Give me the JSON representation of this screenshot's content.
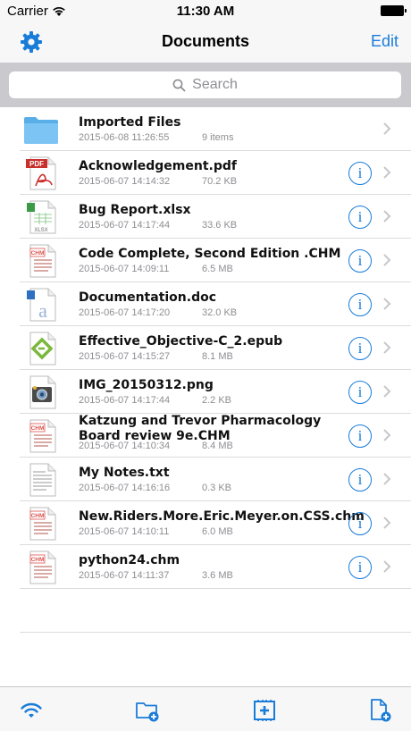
{
  "status": {
    "carrier": "Carrier",
    "time": "11:30 AM"
  },
  "nav": {
    "title": "Documents",
    "edit_label": "Edit"
  },
  "search": {
    "placeholder": "Search"
  },
  "accent_color": "#1a7cd9",
  "files": [
    {
      "name": "Imported Files",
      "date": "2015-06-08 11:26:55",
      "meta": "9 items",
      "icon": "folder-icon"
    },
    {
      "name": "Acknowledgement.pdf",
      "date": "2015-06-07 14:14:32",
      "meta": "70.2 KB",
      "icon": "pdf-file-icon",
      "icon_label": "PDF"
    },
    {
      "name": "Bug Report.xlsx",
      "date": "2015-06-07 14:17:44",
      "meta": "33.6 KB",
      "icon": "xlsx-file-icon",
      "icon_label": "XLSX"
    },
    {
      "name": "Code Complete, Second Edition .CHM",
      "date": "2015-06-07 14:09:11",
      "meta": "6.5 MB",
      "icon": "chm-file-icon",
      "icon_label": "CHM"
    },
    {
      "name": "Documentation.doc",
      "date": "2015-06-07 14:17:20",
      "meta": "32.0 KB",
      "icon": "doc-file-icon"
    },
    {
      "name": "Effective_Objective-C_2.epub",
      "date": "2015-06-07 14:15:27",
      "meta": "8.1 MB",
      "icon": "epub-file-icon"
    },
    {
      "name": "IMG_20150312.png",
      "date": "2015-06-07 14:17:44",
      "meta": "2.2 KB",
      "icon": "image-file-icon"
    },
    {
      "name": "Katzung and Trevor Pharmacology Board review 9e.CHM",
      "date": "2015-06-07 14:10:34",
      "meta": "8.4 MB",
      "icon": "chm-file-icon",
      "icon_label": "CHM"
    },
    {
      "name": "My Notes.txt",
      "date": "2015-06-07 14:16:16",
      "meta": "0.3 KB",
      "icon": "txt-file-icon"
    },
    {
      "name": "New.Riders.More.Eric.Meyer.on.CSS.chm",
      "date": "2015-06-07 14:10:11",
      "meta": "6.0 MB",
      "icon": "chm-file-icon",
      "icon_label": "CHM"
    },
    {
      "name": "python24.chm",
      "date": "2015-06-07 14:11:37",
      "meta": "3.6 MB",
      "icon": "chm-file-icon",
      "icon_label": "CHM"
    }
  ],
  "info_glyph": "i",
  "tab_bar": [
    "wifi-icon",
    "new-folder-icon",
    "add-photo-icon",
    "new-file-icon"
  ]
}
